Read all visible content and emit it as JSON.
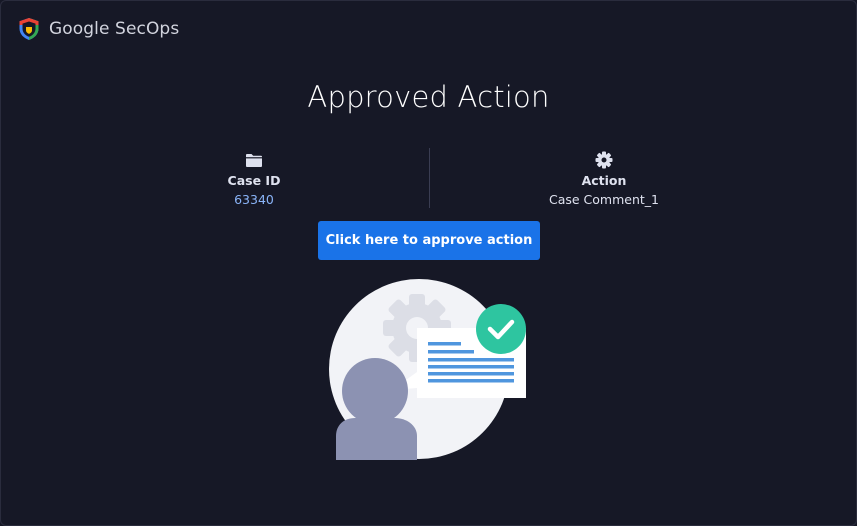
{
  "brand": {
    "name": "Google SecOps",
    "logo_icon": "secops-shield-icon"
  },
  "page": {
    "title": "Approved Action"
  },
  "case_info": {
    "icon": "folder-icon",
    "label": "Case ID",
    "value": "63340"
  },
  "action_info": {
    "icon": "gear-icon",
    "label": "Action",
    "value": "Case Comment_1"
  },
  "approve_button": {
    "label": "Click here to approve action"
  },
  "illustration": {
    "icon": "approved-user-illustration"
  },
  "colors": {
    "background": "#161826",
    "accent": "#1a73e8",
    "link": "#8ab4f8",
    "success": "#2ec5a0"
  }
}
